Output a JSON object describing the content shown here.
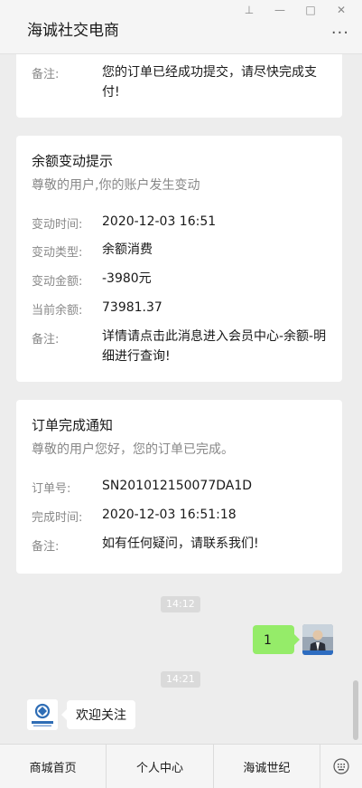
{
  "window": {
    "title": "海诚社交电商",
    "controls": {
      "pin": "⊥",
      "minimize": "—",
      "maximize": "□",
      "close": "✕"
    },
    "more": "···"
  },
  "cards": {
    "order_submit": {
      "remark_label": "备注:",
      "remark_value": "您的订单已经成功提交，请尽快完成支付!"
    },
    "balance_change": {
      "title": "余额变动提示",
      "subtitle": "尊敬的用户,你的账户发生变动",
      "rows": [
        {
          "label": "变动时间:",
          "value": "2020-12-03 16:51"
        },
        {
          "label": "变动类型:",
          "value": "余额消费"
        },
        {
          "label": "变动金额:",
          "value": "-3980元"
        },
        {
          "label": "当前余额:",
          "value": "73981.37"
        },
        {
          "label": "备注:",
          "value": "详情请点击此消息进入会员中心-余额-明细进行查询!"
        }
      ]
    },
    "order_complete": {
      "title": "订单完成通知",
      "subtitle": "尊敬的用户您好，您的订单已完成。",
      "rows": [
        {
          "label": "订单号:",
          "value": "SN201012150077DA1D"
        },
        {
          "label": "完成时间:",
          "value": "2020-12-03 16:51:18"
        },
        {
          "label": "备注:",
          "value": "如有任何疑问，请联系我们!"
        }
      ]
    }
  },
  "messages": {
    "time1": "14:12",
    "my_message": "1",
    "time2": "14:21",
    "other_message": "欢迎关注"
  },
  "menu": {
    "items": [
      "商城首页",
      "个人中心",
      "海诚世纪"
    ],
    "keyboard_icon": "keyboard-icon"
  },
  "colors": {
    "my_bubble": "#95ec69",
    "background": "#ededed"
  }
}
